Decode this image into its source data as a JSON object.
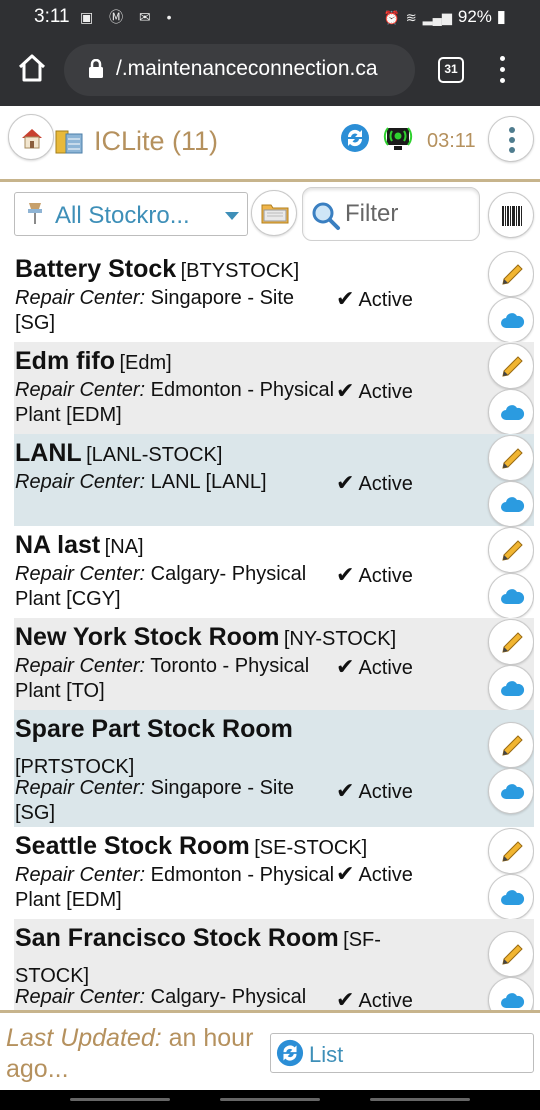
{
  "status_bar": {
    "time": "3:11",
    "notification_icons": [
      "image-icon",
      "m-logo-icon",
      "sms-icon",
      "dot-icon"
    ],
    "right_icons": [
      "alarm-icon",
      "wifi-icon",
      "signal-icon",
      "battery-icon"
    ],
    "battery": "92%"
  },
  "browser": {
    "url": "/.maintenanceconnection.ca",
    "tabs_count": "31"
  },
  "app": {
    "title": "ICLite (11)",
    "clock": "03:11",
    "accent_color": "#b5915e",
    "link_color": "#3e8fb8"
  },
  "toolbar": {
    "stockroom_select": "All Stockro...",
    "filter_placeholder": "Filter"
  },
  "stockrooms": [
    {
      "name": "Battery Stock",
      "code": "[BTYSTOCK]",
      "rc_label": "Repair Center:",
      "rc_value": "Singapore - Site [SG]",
      "status": "Active"
    },
    {
      "name": "Edm fifo",
      "code": "[Edm]",
      "rc_label": "Repair Center:",
      "rc_value": "Edmonton - Physical Plant [EDM]",
      "status": "Active"
    },
    {
      "name": "LANL",
      "code": "[LANL-STOCK]",
      "rc_label": "Repair Center:",
      "rc_value": "LANL [LANL]",
      "status": "Active"
    },
    {
      "name": "NA last",
      "code": "[NA]",
      "rc_label": "Repair Center:",
      "rc_value": "Calgary- Physical Plant [CGY]",
      "status": "Active"
    },
    {
      "name": "New York Stock Room",
      "code": "[NY-STOCK]",
      "rc_label": "Repair Center:",
      "rc_value": "Toronto - Physical Plant [TO]",
      "status": "Active"
    },
    {
      "name": "Spare Part Stock Room",
      "code": "[PRTSTOCK]",
      "rc_label": "Repair Center:",
      "rc_value": "Singapore - Site [SG]",
      "status": "Active"
    },
    {
      "name": "Seattle Stock Room",
      "code": "[SE-STOCK]",
      "rc_label": "Repair Center:",
      "rc_value": "Edmonton - Physical Plant [EDM]",
      "status": "Active"
    },
    {
      "name": "San Francisco Stock Room",
      "code": "[SF-STOCK]",
      "rc_label": "Repair Center:",
      "rc_value": "Calgary- Physical Plant [CGY]",
      "status": "Active"
    }
  ],
  "footer": {
    "updated_label": "Last Updated:",
    "updated_value": "an hour ago...",
    "list_button": "List"
  }
}
